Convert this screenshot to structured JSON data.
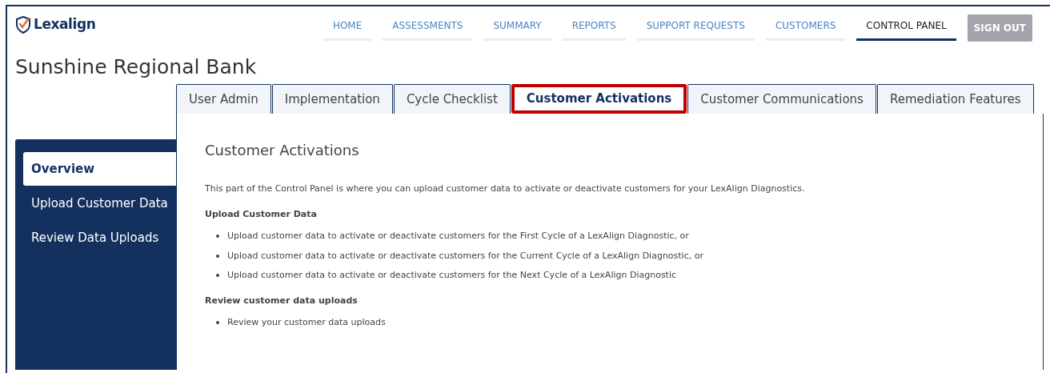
{
  "logo": {
    "text": "Lexalign"
  },
  "nav": [
    {
      "label": "HOME",
      "selected": false
    },
    {
      "label": "ASSESSMENTS",
      "selected": false
    },
    {
      "label": "SUMMARY",
      "selected": false
    },
    {
      "label": "REPORTS",
      "selected": false
    },
    {
      "label": "SUPPORT REQUESTS",
      "selected": false
    },
    {
      "label": "CUSTOMERS",
      "selected": false
    },
    {
      "label": "CONTROL PANEL",
      "selected": true
    }
  ],
  "sign_out": {
    "label": "SIGN OUT"
  },
  "page_title": "Sunshine Regional Bank",
  "tabs": [
    {
      "label": "User Admin",
      "selected": false,
      "highlighted": false
    },
    {
      "label": "Implementation",
      "selected": false,
      "highlighted": false
    },
    {
      "label": "Cycle Checklist",
      "selected": false,
      "highlighted": false
    },
    {
      "label": "Customer Activations",
      "selected": true,
      "highlighted": true
    },
    {
      "label": "Customer Communications",
      "selected": false,
      "highlighted": false
    },
    {
      "label": "Remediation Features",
      "selected": false,
      "highlighted": false
    }
  ],
  "sidebar": {
    "items": [
      {
        "label": "Overview",
        "selected": true
      },
      {
        "label": "Upload Customer Data",
        "selected": false
      },
      {
        "label": "Review Data Uploads",
        "selected": false
      }
    ]
  },
  "content": {
    "heading": "Customer Activations",
    "intro": "This part of the Control Panel is where you can upload customer data to activate or deactivate customers for your LexAlign Diagnostics.",
    "sections": [
      {
        "title": "Upload Customer Data",
        "bullets": [
          "Upload customer data to activate or deactivate customers for the First Cycle of a LexAlign Diagnostic, or",
          "Upload customer data to activate or deactivate customers for the Current Cycle of a LexAlign Diagnostic, or",
          "Upload customer data to activate or deactivate customers for the Next Cycle of a LexAlign Diagnostic"
        ]
      },
      {
        "title": "Review customer data uploads",
        "bullets": [
          "Review your customer data uploads"
        ]
      }
    ]
  }
}
